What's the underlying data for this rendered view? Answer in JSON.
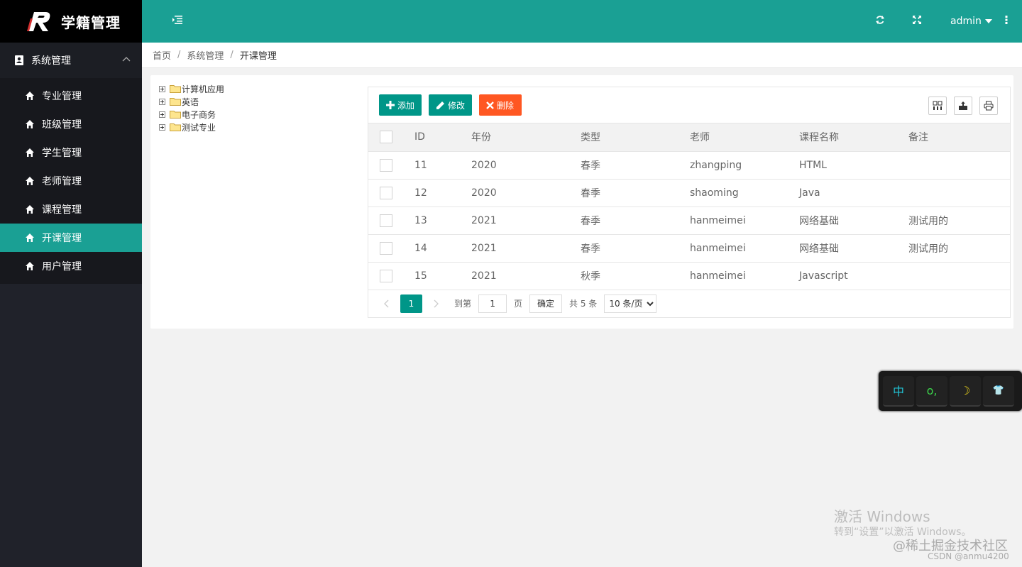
{
  "app": {
    "title": "学籍管理"
  },
  "sidebar": {
    "group": {
      "label": "系统管理"
    },
    "items": [
      {
        "label": "专业管理",
        "active": false
      },
      {
        "label": "班级管理",
        "active": false
      },
      {
        "label": "学生管理",
        "active": false
      },
      {
        "label": "老师管理",
        "active": false
      },
      {
        "label": "课程管理",
        "active": false
      },
      {
        "label": "开课管理",
        "active": true
      },
      {
        "label": "用户管理",
        "active": false
      }
    ]
  },
  "header": {
    "user": "admin"
  },
  "breadcrumb": [
    "首页",
    "系统管理",
    "开课管理"
  ],
  "tree": [
    "计算机应用",
    "英语",
    "电子商务",
    "测试专业"
  ],
  "toolbar": {
    "add": "添加",
    "edit": "修改",
    "delete": "删除"
  },
  "table": {
    "columns": [
      "ID",
      "年份",
      "类型",
      "老师",
      "课程名称",
      "备注"
    ],
    "rows": [
      [
        "11",
        "2020",
        "春季",
        "zhangping",
        "HTML",
        ""
      ],
      [
        "12",
        "2020",
        "春季",
        "shaoming",
        "Java",
        ""
      ],
      [
        "13",
        "2021",
        "春季",
        "hanmeimei",
        "网络基础",
        "测试用的"
      ],
      [
        "14",
        "2021",
        "春季",
        "hanmeimei",
        "网络基础",
        "测试用的"
      ],
      [
        "15",
        "2021",
        "秋季",
        "hanmeimei",
        "Javascript",
        ""
      ]
    ]
  },
  "pager": {
    "current": "1",
    "goto_label": "到第",
    "page_input": "1",
    "page_unit": "页",
    "confirm": "确定",
    "total": "共 5 条",
    "per_page": "10 条/页"
  },
  "ime": {
    "keys": [
      "中",
      "o,",
      "☽",
      "👕"
    ]
  },
  "watermark": {
    "line1": "激活 Windows",
    "line2": "转到“设置”以激活 Windows。",
    "line3": "@稀土掘金技术社区",
    "line4": "CSDN @anmu4200"
  },
  "colors": {
    "primary": "#1aa094",
    "danger": "#ff5722",
    "sidebar": "#20222a"
  }
}
